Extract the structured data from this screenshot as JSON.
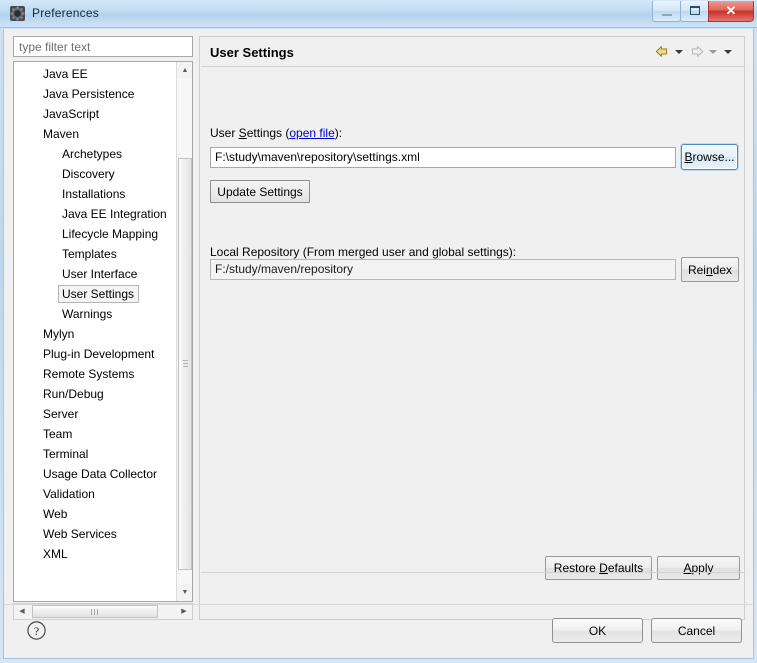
{
  "window": {
    "title": "Preferences",
    "icon": "preferences-gear-icon",
    "controls": {
      "minimize": "minimize-icon",
      "maximize": "maximize-icon",
      "close": "✕"
    }
  },
  "filter": {
    "placeholder": "type filter text",
    "value": ""
  },
  "tree": {
    "items": [
      {
        "label": "Java EE",
        "level": 1,
        "selected": false
      },
      {
        "label": "Java Persistence",
        "level": 1,
        "selected": false
      },
      {
        "label": "JavaScript",
        "level": 1,
        "selected": false
      },
      {
        "label": "Maven",
        "level": 1,
        "selected": false
      },
      {
        "label": "Archetypes",
        "level": 2,
        "selected": false
      },
      {
        "label": "Discovery",
        "level": 2,
        "selected": false
      },
      {
        "label": "Installations",
        "level": 2,
        "selected": false
      },
      {
        "label": "Java EE Integration",
        "level": 2,
        "selected": false
      },
      {
        "label": "Lifecycle Mapping",
        "level": 2,
        "selected": false
      },
      {
        "label": "Templates",
        "level": 2,
        "selected": false
      },
      {
        "label": "User Interface",
        "level": 2,
        "selected": false
      },
      {
        "label": "User Settings",
        "level": 2,
        "selected": true
      },
      {
        "label": "Warnings",
        "level": 2,
        "selected": false
      },
      {
        "label": "Mylyn",
        "level": 1,
        "selected": false
      },
      {
        "label": "Plug-in Development",
        "level": 1,
        "selected": false
      },
      {
        "label": "Remote Systems",
        "level": 1,
        "selected": false
      },
      {
        "label": "Run/Debug",
        "level": 1,
        "selected": false
      },
      {
        "label": "Server",
        "level": 1,
        "selected": false
      },
      {
        "label": "Team",
        "level": 1,
        "selected": false
      },
      {
        "label": "Terminal",
        "level": 1,
        "selected": false
      },
      {
        "label": "Usage Data Collector",
        "level": 1,
        "selected": false
      },
      {
        "label": "Validation",
        "level": 1,
        "selected": false
      },
      {
        "label": "Web",
        "level": 1,
        "selected": false
      },
      {
        "label": "Web Services",
        "level": 1,
        "selected": false
      },
      {
        "label": "XML",
        "level": 1,
        "selected": false
      }
    ],
    "scrollbars": {
      "up_arrow": "▲",
      "down_arrow": "▼",
      "left_arrow": "◀",
      "right_arrow": "▶"
    }
  },
  "page": {
    "title": "User Settings",
    "nav": {
      "back": "back-arrow-icon",
      "back_menu": "back-dropdown-icon",
      "forward": "forward-arrow-icon",
      "forward_menu": "forward-dropdown-icon",
      "view_menu": "view-menu-icon"
    },
    "user_settings": {
      "label_prefix": "User ",
      "label_mnemonic": "S",
      "label_suffix": "ettings (",
      "link": "open file",
      "label_end": "):",
      "value": "F:\\study\\maven\\repository\\settings.xml",
      "browse_prefix": "",
      "browse_mnemonic": "B",
      "browse_suffix": "rowse...",
      "update_button": "Update Settings"
    },
    "local_repository": {
      "label": "Local Repository (From merged user and global settings):",
      "value": "F:/study/maven/repository",
      "reindex_prefix": "Rei",
      "reindex_mnemonic": "n",
      "reindex_suffix": "dex"
    },
    "restore_defaults": {
      "prefix": "Restore ",
      "mnemonic": "D",
      "suffix": "efaults"
    },
    "apply": {
      "prefix": "",
      "mnemonic": "A",
      "suffix": "pply"
    }
  },
  "footer": {
    "help_icon": "help-icon",
    "ok": "OK",
    "cancel": "Cancel"
  }
}
